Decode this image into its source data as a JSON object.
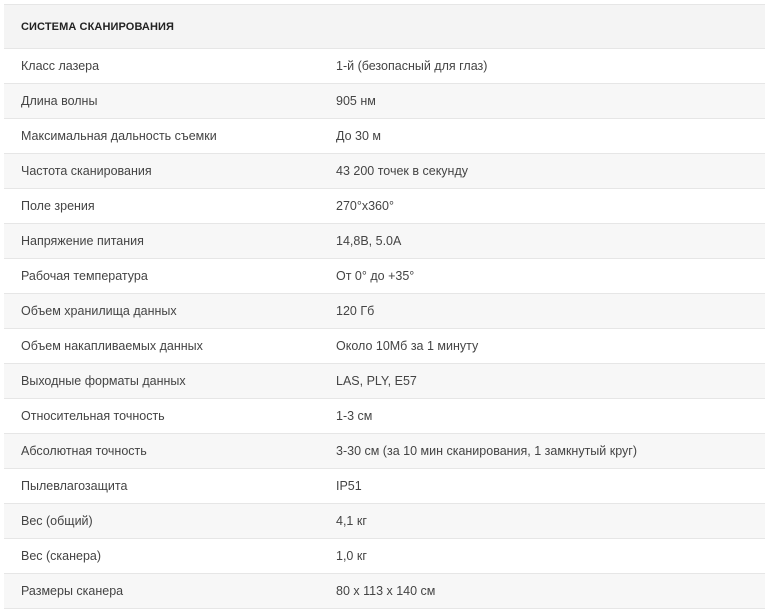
{
  "section_title": "СИСТЕМА СКАНИРОВАНИЯ",
  "rows": [
    {
      "name": "Класс лазера",
      "value": "1-й (безопасный для глаз)"
    },
    {
      "name": "Длина волны",
      "value": "905 нм"
    },
    {
      "name": "Максимальная дальность съемки",
      "value": "До 30 м"
    },
    {
      "name": "Частота сканирования",
      "value": "43 200 точек в секунду"
    },
    {
      "name": "Поле зрения",
      "value": "270°x360°"
    },
    {
      "name": "Напряжение питания",
      "value": "14,8В, 5.0А"
    },
    {
      "name": "Рабочая температура",
      "value": "От 0° до +35°"
    },
    {
      "name": "Объем хранилища данных",
      "value": "120 Гб"
    },
    {
      "name": "Объем накапливаемых данных",
      "value": "Около 10Мб за 1 минуту"
    },
    {
      "name": "Выходные форматы данных",
      "value": "LAS, PLY, E57"
    },
    {
      "name": "Относительная точность",
      "value": "1-3 см"
    },
    {
      "name": "Абсолютная точность",
      "value": "3-30 см (за 10 мин сканирования, 1 замкнутый круг)"
    },
    {
      "name": "Пылевлагозащита",
      "value": "IP51"
    },
    {
      "name": "Вес (общий)",
      "value": "4,1 кг"
    },
    {
      "name": "Вес (сканера)",
      "value": "1,0 кг"
    },
    {
      "name": "Размеры сканера",
      "value": "80 x 113 x 140 см"
    }
  ]
}
